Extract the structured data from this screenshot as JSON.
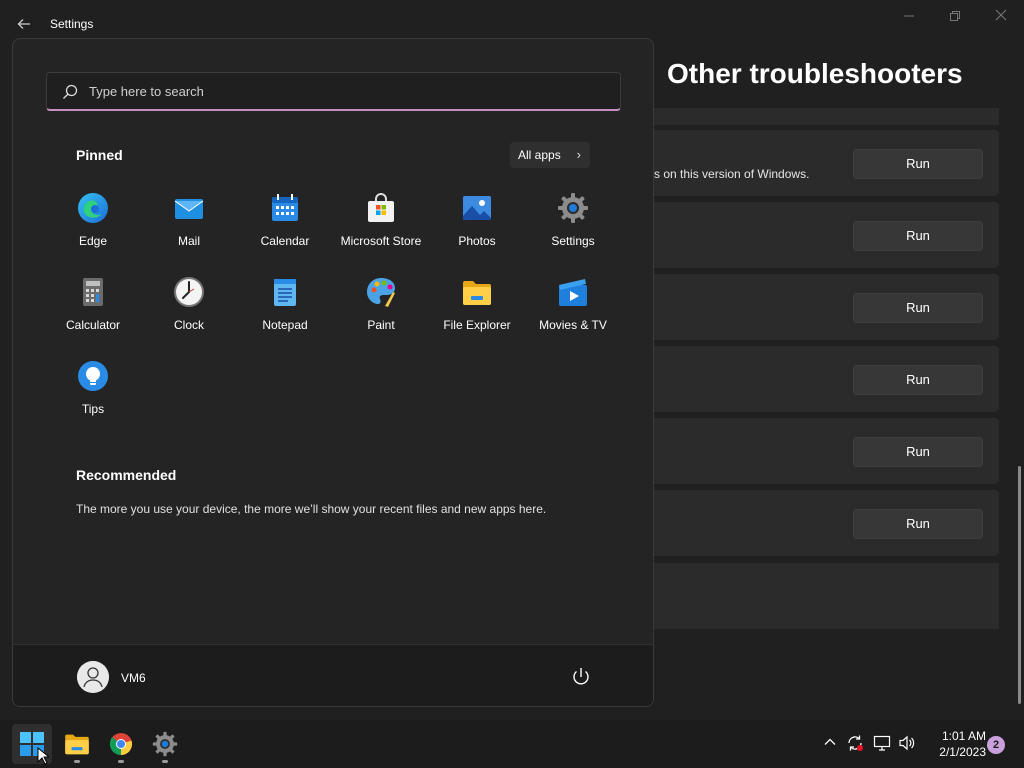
{
  "window": {
    "title": "Settings",
    "back_icon": "back-arrow-icon",
    "page_heading": "Other troubleshooters"
  },
  "troubleshooters": [
    {
      "description": "s on this version of Windows.",
      "button_label": "Run"
    },
    {
      "description": "",
      "button_label": "Run"
    },
    {
      "description": "",
      "button_label": "Run"
    },
    {
      "description": "",
      "button_label": "Run"
    },
    {
      "description": "",
      "button_label": "Run"
    },
    {
      "description": "",
      "button_label": "Run"
    }
  ],
  "start_menu": {
    "search": {
      "placeholder": "Type here to search",
      "value": ""
    },
    "pinned_title": "Pinned",
    "all_apps_label": "All apps",
    "pinned": [
      {
        "label": "Edge",
        "icon": "edge-icon"
      },
      {
        "label": "Mail",
        "icon": "mail-icon"
      },
      {
        "label": "Calendar",
        "icon": "calendar-icon"
      },
      {
        "label": "Microsoft Store",
        "icon": "store-icon"
      },
      {
        "label": "Photos",
        "icon": "photos-icon"
      },
      {
        "label": "Settings",
        "icon": "settings-gear-icon"
      },
      {
        "label": "Calculator",
        "icon": "calculator-icon"
      },
      {
        "label": "Clock",
        "icon": "clock-icon"
      },
      {
        "label": "Notepad",
        "icon": "notepad-icon"
      },
      {
        "label": "Paint",
        "icon": "paint-icon"
      },
      {
        "label": "File Explorer",
        "icon": "folder-icon"
      },
      {
        "label": "Movies & TV",
        "icon": "movies-icon"
      },
      {
        "label": "Tips",
        "icon": "tips-lightbulb-icon"
      }
    ],
    "recommended_title": "Recommended",
    "recommended_text": "The more you use your device, the more we’ll show your recent files and new apps here.",
    "user_name": "VM6"
  },
  "taskbar": {
    "apps": [
      "start-icon",
      "file-explorer-icon",
      "chrome-icon",
      "settings-gear-icon"
    ],
    "time": "1:01 AM",
    "date": "2/1/2023",
    "notification_count": "2"
  },
  "colors": {
    "search_accent": "#c88fc2",
    "notification_badge": "#c9a0dc"
  }
}
